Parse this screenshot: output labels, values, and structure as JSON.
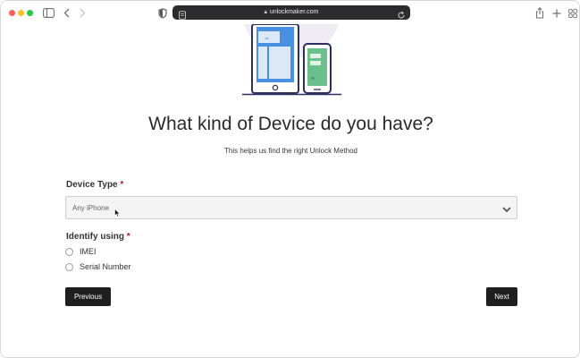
{
  "browser": {
    "url": "unlockmaker.com",
    "icons": {
      "sidebar": "sidebar-icon",
      "back": "chevron-left-icon",
      "forward": "chevron-right-icon",
      "privacy": "shield-icon",
      "reload": "reload-icon",
      "share": "share-icon",
      "new_tab": "plus-icon",
      "tab_overview": "grid-icon"
    }
  },
  "page": {
    "title": "What kind of Device do you have?",
    "subtitle": "This helps us find the right Unlock Method"
  },
  "form": {
    "device_type": {
      "label": "Device Type",
      "required_mark": "*",
      "selected_value": "Any iPhone"
    },
    "identify": {
      "label": "Identify using",
      "required_mark": "*",
      "options": [
        {
          "label": "IMEI",
          "selected": false
        },
        {
          "label": "Serial Number",
          "selected": false
        }
      ]
    },
    "buttons": {
      "previous": "Previous",
      "next": "Next"
    }
  },
  "colors": {
    "accent_blue": "#4a90e2",
    "accent_green": "#6bbf8a",
    "button_dark": "#1f1f1f",
    "required_red": "#c8102e"
  }
}
